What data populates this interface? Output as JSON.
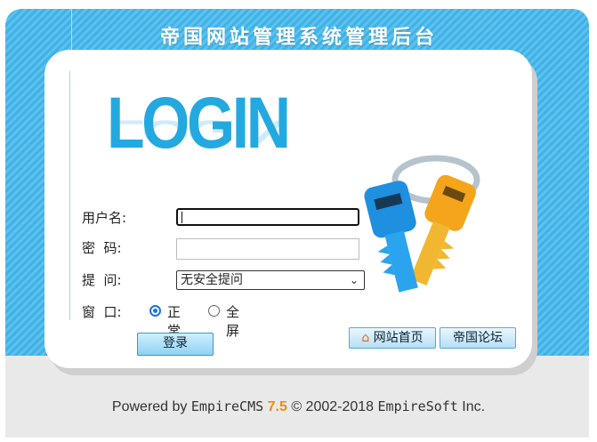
{
  "header": {
    "title": "帝国网站管理系统管理后台"
  },
  "logo": {
    "text": "LOGIN"
  },
  "form": {
    "username_label": "用户名:",
    "password_label": "密  码:",
    "question_label": "提  问:",
    "window_label": "窗  口:",
    "question_value": "无安全提问",
    "window_options": {
      "normal": "正常",
      "fullscreen": "全屏"
    },
    "window_selected": "正常",
    "login_button": "登录"
  },
  "links": {
    "home": "网站首页",
    "forum": "帝国论坛"
  },
  "footer": {
    "powered_by": "Powered by",
    "brand": "EmpireCMS",
    "version": "7.5",
    "copyright": "© 2002-2018",
    "company": "EmpireSoft",
    "suffix": "Inc."
  },
  "icons": [
    "home-icon",
    "keys-illustration",
    "chevron-down-icon"
  ],
  "colors": {
    "accent": "#23a9e0",
    "band": "#3fb2e6",
    "version": "#f08a14"
  }
}
